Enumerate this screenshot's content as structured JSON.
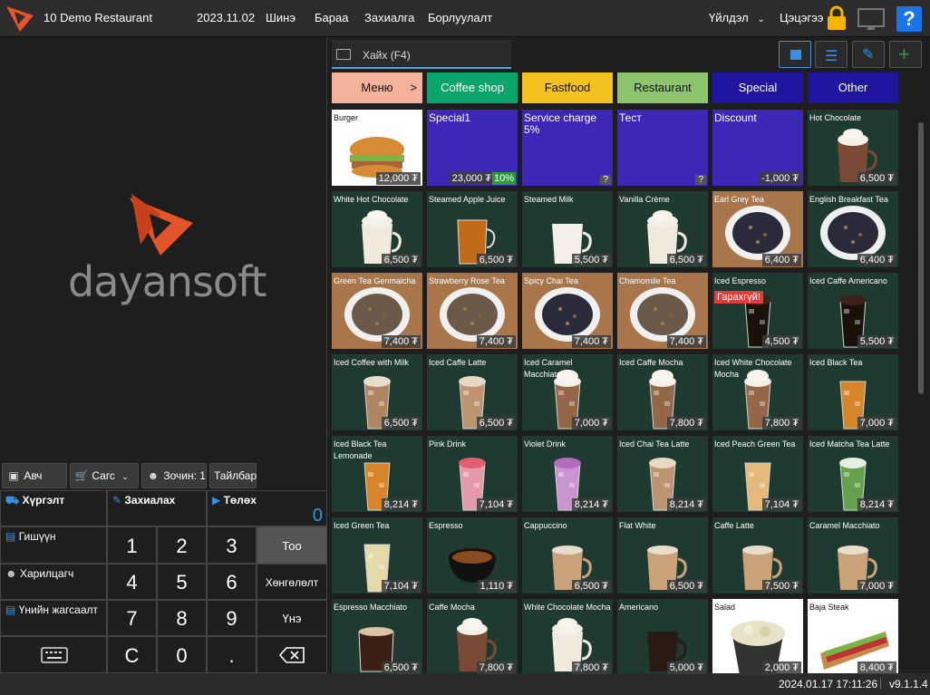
{
  "topbar": {
    "title": "10 Demo Restaurant",
    "date": "2023.11.02",
    "menu": [
      "Шинэ",
      "Бараа",
      "Захиалга",
      "Борлуулалт"
    ],
    "actions_label": "Үйлдэл",
    "settings_label": "Цэцэгээ"
  },
  "brand": {
    "name": "dayansoft"
  },
  "left_actions": [
    {
      "label": "Авч явах",
      "icon": "bag-icon"
    },
    {
      "label": "Сагс",
      "icon": "cart-icon"
    },
    {
      "label": "Зочин: 1",
      "icon": "user-icon"
    },
    {
      "label": "Тайлбар",
      "icon": ""
    }
  ],
  "pad": {
    "delivery": "Хүргэлт",
    "order": "Захиалах",
    "pay": "Төлөх",
    "amount": "0",
    "member": "Гишүүн",
    "customer": "Харилцагч",
    "price_list": "Үнийн жагсаалт",
    "digits": [
      "1",
      "2",
      "3",
      "4",
      "5",
      "6",
      "7",
      "8",
      "9"
    ],
    "clear": "C",
    "zero": "0",
    "dot": ".",
    "qty": "Тоо",
    "discount": "Хөнгөлөлт",
    "price": "Үнэ"
  },
  "search": {
    "placeholder": "Хайх (F4)"
  },
  "categories": [
    {
      "label": "Меню",
      "color": "#f5b29b",
      "text": "#111",
      "suffix": ">"
    },
    {
      "label": "Coffee shop",
      "color": "#0aa56c",
      "text": "#fff",
      "suffix": ""
    },
    {
      "label": "Fastfood",
      "color": "#f4c21f",
      "text": "#111",
      "suffix": ""
    },
    {
      "label": "Restaurant",
      "color": "#8dc46e",
      "text": "#111",
      "suffix": ""
    },
    {
      "label": "Special",
      "color": "#1f16a0",
      "text": "#fff",
      "suffix": ""
    },
    {
      "label": "Other",
      "color": "#1f16a0",
      "text": "#fff",
      "suffix": ""
    }
  ],
  "products": [
    [
      {
        "name": "Burger",
        "price": "12,000 ₮",
        "style": "white",
        "img": "burger"
      },
      {
        "name": "Special1",
        "price": "23,000 ₮",
        "style": "purple",
        "badge": "10%"
      },
      {
        "name": "Service charge 5%",
        "price": "",
        "style": "purple",
        "q": "?"
      },
      {
        "name": "Тест",
        "price": "",
        "style": "purple",
        "q": "?"
      },
      {
        "name": "Discount",
        "price": "-1,000 ₮",
        "style": "purple"
      },
      {
        "name": "Hot Chocolate",
        "price": "6,500 ₮",
        "img": "cup-brown-cream"
      }
    ],
    [
      {
        "name": "White Hot Chocolate",
        "price": "6,500 ₮",
        "img": "cup-white-cream"
      },
      {
        "name": "Steamed Apple Juice",
        "price": "6,500 ₮",
        "img": "glass-amber"
      },
      {
        "name": "Steamed Milk",
        "price": "5,500 ₮",
        "img": "cup-white"
      },
      {
        "name": "Vanilla Crème",
        "price": "6,500 ₮",
        "img": "cup-white-cream"
      },
      {
        "name": "Earl Grey Tea",
        "price": "6,400 ₮",
        "img": "bowl-dark",
        "style": "wood"
      },
      {
        "name": "English Breakfast Tea",
        "price": "6,400 ₮",
        "img": "bowl-dark"
      }
    ],
    [
      {
        "name": "Green Tea Genmaicha",
        "price": "7,400 ₮",
        "img": "bowl-mixed",
        "style": "wood"
      },
      {
        "name": "Strawberry Rose Tea",
        "price": "7,400 ₮",
        "img": "bowl-mixed",
        "style": "wood"
      },
      {
        "name": "Spicy Chai Tea",
        "price": "7,400 ₮",
        "img": "bowl-dark",
        "style": "wood"
      },
      {
        "name": "Chamomile Tea",
        "price": "7,400 ₮",
        "img": "bowl-mixed",
        "style": "wood"
      },
      {
        "name": "Iced Espresso",
        "price": "4,500 ₮",
        "img": "iced-dark",
        "out": "Гарахгүй!"
      },
      {
        "name": "Iced Caffe Americano",
        "price": "5,500 ₮",
        "img": "iced-dark"
      }
    ],
    [
      {
        "name": "Iced Coffee with Milk",
        "price": "6,500 ₮",
        "img": "iced-milk"
      },
      {
        "name": "Iced Caffe Latte",
        "price": "6,500 ₮",
        "img": "iced-latte"
      },
      {
        "name": "Iced Caramel Macchiato",
        "price": "7,000 ₮",
        "img": "iced-cream"
      },
      {
        "name": "Iced Caffe Mocha",
        "price": "7,800 ₮",
        "img": "iced-cream"
      },
      {
        "name": "Iced White Chocolate Mocha",
        "price": "7,800 ₮",
        "img": "iced-cream"
      },
      {
        "name": "Iced Black Tea",
        "price": "7,000 ₮",
        "img": "iced-orange"
      }
    ],
    [
      {
        "name": "Iced Black Tea Lemonade",
        "price": "8,214 ₮",
        "img": "iced-orange"
      },
      {
        "name": "Pink Drink",
        "price": "7,104 ₮",
        "img": "iced-pink"
      },
      {
        "name": "Violet Drink",
        "price": "8,214 ₮",
        "img": "iced-violet"
      },
      {
        "name": "Iced Chai Tea Latte",
        "price": "8,214 ₮",
        "img": "iced-latte"
      },
      {
        "name": "Iced Peach Green Tea",
        "price": "7,104 ₮",
        "img": "iced-peach"
      },
      {
        "name": "Iced Matcha Tea Latte",
        "price": "8,214 ₮",
        "img": "iced-green"
      }
    ],
    [
      {
        "name": "Iced Green Tea",
        "price": "7,104 ₮",
        "img": "iced-pale"
      },
      {
        "name": "Espresso",
        "price": "1,110 ₮",
        "img": "cup-espresso"
      },
      {
        "name": "Cappuccino",
        "price": "6,500 ₮",
        "img": "cup-foam"
      },
      {
        "name": "Flat White",
        "price": "6,500 ₮",
        "img": "cup-foam"
      },
      {
        "name": "Caffe Latte",
        "price": "7,500 ₮",
        "img": "cup-foam"
      },
      {
        "name": "Caramel Macchiato",
        "price": "7,000 ₮",
        "img": "cup-foam"
      }
    ],
    [
      {
        "name": "Espresso Macchiato",
        "price": "6,500 ₮",
        "img": "glass-dark"
      },
      {
        "name": "Caffe Mocha",
        "price": "7,800 ₮",
        "img": "cup-brown-cream"
      },
      {
        "name": "White Chocolate Mocha",
        "price": "7,800 ₮",
        "img": "cup-white-cream"
      },
      {
        "name": "Americano",
        "price": "5,000 ₮",
        "img": "cup-dark"
      },
      {
        "name": "Salad",
        "price": "2,000 ₮",
        "style": "white",
        "img": "salad"
      },
      {
        "name": "Baja Steak",
        "price": "8,400 ₮",
        "style": "white",
        "img": "sandwich"
      }
    ]
  ],
  "status": {
    "datetime": "2024.01.17 17:11:26",
    "version": "v9.1.1.4"
  }
}
